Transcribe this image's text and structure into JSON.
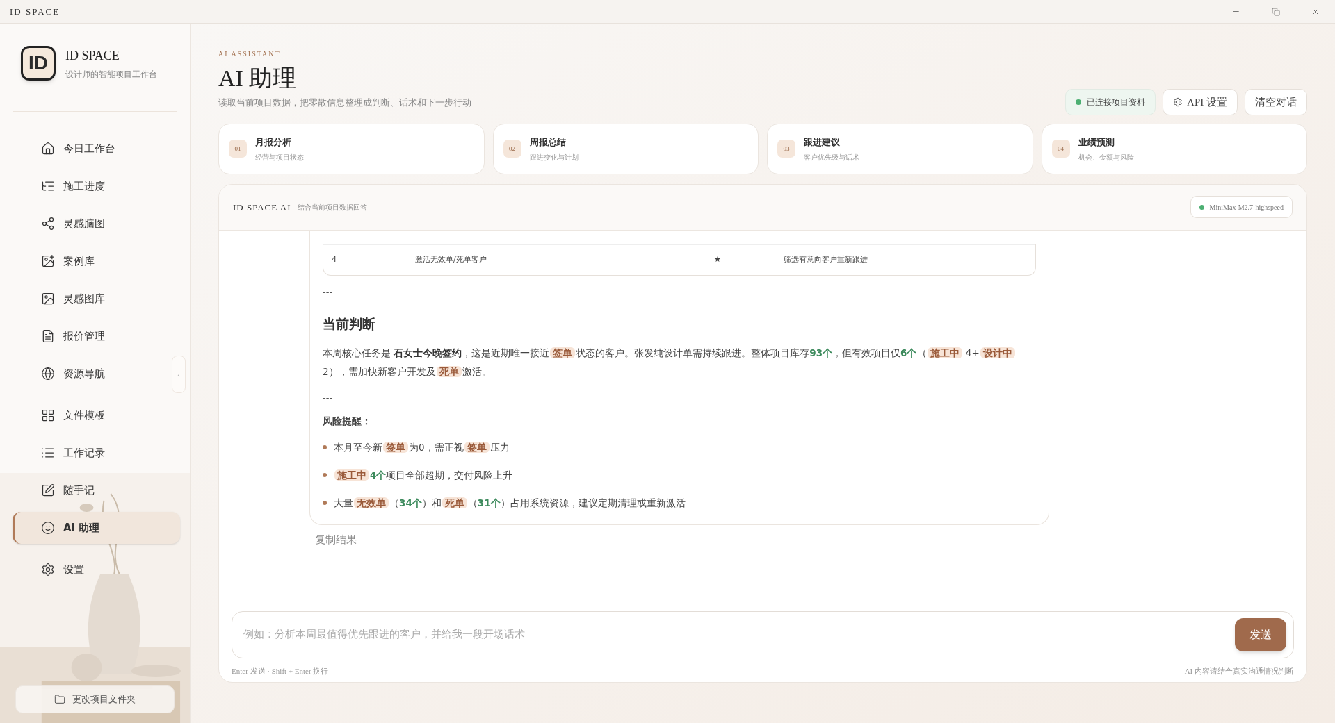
{
  "window": {
    "title": "ID SPACE"
  },
  "sidebar": {
    "brand": {
      "logo": "ID",
      "name": "ID SPACE",
      "tagline": "设计师的智能项目工作台"
    },
    "items": [
      {
        "label": "今日工作台",
        "selected": false
      },
      {
        "label": "施工进度",
        "selected": false
      },
      {
        "label": "灵感脑图",
        "selected": false
      },
      {
        "label": "案例库",
        "selected": false
      },
      {
        "label": "灵感图库",
        "selected": false
      },
      {
        "label": "报价管理",
        "selected": false
      },
      {
        "label": "资源导航",
        "selected": false
      },
      {
        "label": "文件模板",
        "selected": false
      },
      {
        "label": "工作记录",
        "selected": false
      },
      {
        "label": "随手记",
        "selected": false
      },
      {
        "label": "AI 助理",
        "selected": true
      },
      {
        "label": "设置",
        "selected": false
      }
    ],
    "collapse": "‹",
    "folder_button": "更改项目文件夹"
  },
  "header": {
    "eyebrow": "AI ASSISTANT",
    "title": "AI 助理",
    "subtitle": "读取当前项目数据，把零散信息整理成判断、话术和下一步行动",
    "status": {
      "label": "已连接项目资料",
      "color": "#4caf72"
    },
    "buttons": [
      {
        "label": "API 设置",
        "kind": "settings"
      },
      {
        "label": "清空对话",
        "kind": "plain"
      }
    ]
  },
  "shortcuts": [
    {
      "number": "01",
      "title": "月报分析",
      "subtitle": "经营与项目状态"
    },
    {
      "number": "02",
      "title": "周报总结",
      "subtitle": "跟进变化与计划"
    },
    {
      "number": "03",
      "title": "跟进建议",
      "subtitle": "客户优先级与话术"
    },
    {
      "number": "04",
      "title": "业绩预测",
      "subtitle": "机会、金额与风险"
    }
  ],
  "chat": {
    "title": "ID SPACE AI",
    "subtitle": "结合当前项目数据回答",
    "model": {
      "label": "MiniMax-M2.7-highspeed",
      "color": "#4caf72"
    },
    "table_rows": [
      [
        "4",
        "激活无效单/死单客户",
        "★",
        "筛选有意向客户重新跟进"
      ]
    ],
    "blocks": [
      {
        "kind": "rule",
        "text": "---"
      },
      {
        "kind": "heading",
        "text": "当前判断"
      },
      {
        "kind": "paragraph",
        "segments": [
          {
            "kind": "text",
            "text": "本周核心任务是 "
          },
          {
            "kind": "bold",
            "text": "石女士今晚签约"
          },
          {
            "kind": "text",
            "text": "，这是近期唯一接近"
          },
          {
            "kind": "tag",
            "text": "签单"
          },
          {
            "kind": "text",
            "text": "状态的客户。张发纯设计单需持续跟进。整体项目库存"
          },
          {
            "kind": "num",
            "text": "93个"
          },
          {
            "kind": "text",
            "text": "，但有效项目仅"
          },
          {
            "kind": "num",
            "text": "6个"
          },
          {
            "kind": "text",
            "text": "（"
          },
          {
            "kind": "tag",
            "text": "施工中"
          },
          {
            "kind": "text",
            "text": " 4+"
          },
          {
            "kind": "tag",
            "text": "设计中"
          },
          {
            "kind": "text",
            "text": "2），需加快新客户开发及"
          },
          {
            "kind": "tag",
            "text": "死单"
          },
          {
            "kind": "text",
            "text": "激活。"
          }
        ]
      },
      {
        "kind": "rule",
        "text": "---"
      },
      {
        "kind": "label",
        "text": "风险提醒："
      },
      {
        "kind": "bullet",
        "segments": [
          {
            "kind": "text",
            "text": "本月至今新"
          },
          {
            "kind": "tag",
            "text": "签单"
          },
          {
            "kind": "text",
            "text": "为0，需正视"
          },
          {
            "kind": "tag",
            "text": "签单"
          },
          {
            "kind": "text",
            "text": "压力"
          }
        ]
      },
      {
        "kind": "bullet",
        "segments": [
          {
            "kind": "tag",
            "text": "施工中"
          },
          {
            "kind": "num",
            "text": "4个"
          },
          {
            "kind": "text",
            "text": "项目全部超期，交付风险上升"
          }
        ]
      },
      {
        "kind": "bullet",
        "segments": [
          {
            "kind": "text",
            "text": "大量"
          },
          {
            "kind": "tag",
            "text": "无效单"
          },
          {
            "kind": "text",
            "text": "（"
          },
          {
            "kind": "num",
            "text": "34个"
          },
          {
            "kind": "text",
            "text": "）和"
          },
          {
            "kind": "tag",
            "text": "死单"
          },
          {
            "kind": "text",
            "text": "（"
          },
          {
            "kind": "num",
            "text": "31个"
          },
          {
            "kind": "text",
            "text": "）占用系统资源，建议定期清理或重新激活"
          }
        ]
      }
    ],
    "copy": "复制结果",
    "input": {
      "placeholder": "例如：分析本周最值得优先跟进的客户，并给我一段开场话术"
    },
    "send": "发送",
    "hint_left": "Enter 发送 · Shift + Enter 换行",
    "hint_right": "AI 内容请结合真实沟通情况判断"
  }
}
